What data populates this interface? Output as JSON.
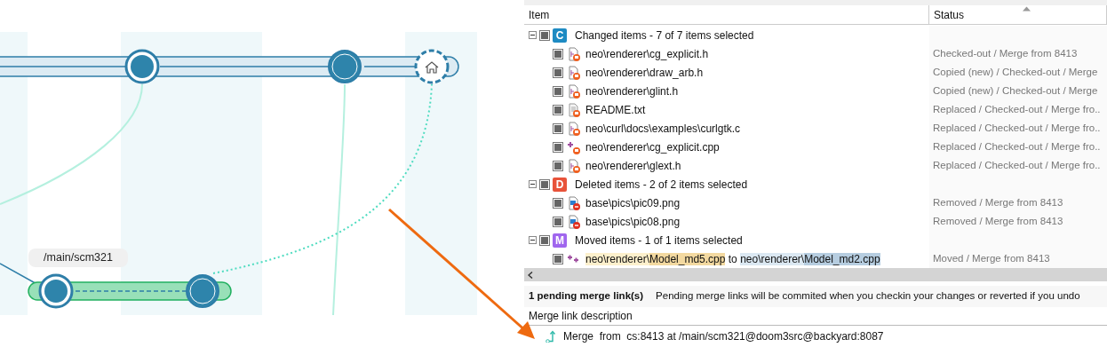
{
  "diagram": {
    "branch_label": "/main/scm321"
  },
  "table": {
    "columns": [
      {
        "label": "Item",
        "sorted": false
      },
      {
        "label": "Status",
        "sorted": true
      }
    ],
    "groups": [
      {
        "badge": "C",
        "color": "#1e8bc3",
        "label": "Changed items - 7 of 7 items selected",
        "expanded": true,
        "checked": true,
        "items": [
          {
            "kind": "header",
            "path": "neo\\renderer\\cg_explicit.h",
            "status": "Checked-out / Merge from 8413",
            "checked": true
          },
          {
            "kind": "header",
            "path": "neo\\renderer\\draw_arb.h",
            "status": "Copied (new) / Checked-out / Merge",
            "checked": true
          },
          {
            "kind": "header",
            "path": "neo\\renderer\\glint.h",
            "status": "Copied (new) / Checked-out / Merge",
            "checked": true
          },
          {
            "kind": "text",
            "path": "README.txt",
            "status": "Replaced / Checked-out / Merge fro..",
            "checked": true
          },
          {
            "kind": "header",
            "path": "neo\\curl\\docs\\examples\\curlgtk.c",
            "status": "Replaced / Checked-out / Merge fro..",
            "checked": true
          },
          {
            "kind": "added",
            "path": "neo\\renderer\\cg_explicit.cpp",
            "status": "Replaced / Checked-out / Merge fro..",
            "checked": true
          },
          {
            "kind": "header",
            "path": "neo\\renderer\\glext.h",
            "status": "Replaced / Checked-out / Merge fro..",
            "checked": true
          }
        ]
      },
      {
        "badge": "D",
        "color": "#e8533a",
        "label": "Deleted items - 2 of 2 items selected",
        "expanded": true,
        "checked": true,
        "items": [
          {
            "kind": "image",
            "path": "base\\pics\\pic09.png",
            "status": "Removed / Merge from 8413",
            "checked": true
          },
          {
            "kind": "image",
            "path": "base\\pics\\pic08.png",
            "status": "Removed / Merge from 8413",
            "checked": true
          }
        ]
      },
      {
        "badge": "M",
        "color": "#a066ee",
        "label": "Moved items - 1 of 1 items selected",
        "expanded": true,
        "checked": true,
        "items": [
          {
            "kind": "moved",
            "parts": [
              {
                "kind": "from_dir",
                "text": "neo\\renderer\\"
              },
              {
                "kind": "from_name",
                "text": "Model_md5.cpp"
              },
              {
                "kind": "plain",
                "text": " to "
              },
              {
                "kind": "to_dir",
                "text": "neo\\renderer\\"
              },
              {
                "kind": "to_name",
                "text": "Model_md2.cpp"
              }
            ],
            "status": "Moved / Merge from 8413",
            "checked": true
          }
        ]
      }
    ]
  },
  "pending": {
    "count": "1 pending merge link(s)",
    "message": "Pending merge links will be commited when you checkin your changes or reverted if you undo"
  },
  "merge_links": {
    "heading": "Merge link description",
    "items": [
      {
        "text": "Merge  from  cs:8413 at /main/scm321@doom3src@backyard:8087"
      }
    ]
  }
}
